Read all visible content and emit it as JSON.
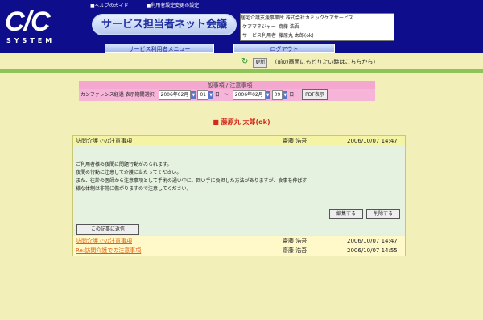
{
  "logo": {
    "text": "C/C",
    "sub": "SYSTEM"
  },
  "toplinks": [
    "■ヘルプのガイド",
    "■利用者設定変更の設定"
  ],
  "title": "サービス担当者ネット会議",
  "info": {
    "office": "居宅介護支援事業所 株式会社カミックケアサービス",
    "caremanager_label": "ケアマネジャー",
    "caremanager": "齋藤 浩吾",
    "user_label": "サービス利用者",
    "user": "藤原丸 太郎(ok)"
  },
  "nav": {
    "menu": "サービス利用者メニュー",
    "logout": "ログアウト"
  },
  "refresh": {
    "button": "更新",
    "text": "（前の画面にもどりたい時はこちらから）"
  },
  "filter": {
    "title": "一般事項 / 注意事項",
    "label": "カンファレンス経過 表示期間選択",
    "from_year": "2006年02月",
    "from_month": "01",
    "from_unit": "日",
    "tilde": "〜",
    "to_year": "2006年02月",
    "to_month": "09",
    "to_unit": "日",
    "pdf": "PDF表示"
  },
  "patient": "■ 藤原丸 太郎(ok)",
  "panel": {
    "head": {
      "title": "訪問介護での注意事項",
      "author": "齋藤 浩吾",
      "date": "2006/10/07 14:47"
    },
    "body": [
      "ご利用者様の夜間に問題行動がみられます。",
      "夜間の行動に注意して介護に当たってください。",
      "また、往診の医師から注意事項として手術の通い中に、回い手に負担した方法がありますが、食事を伸ばす",
      "様な体制は非常に傷がりますので注意してください。"
    ],
    "edit": "編集する",
    "delete": "削除する",
    "use": "この記事に返信",
    "rows": [
      {
        "title": "訪問介護での注意事項",
        "author": "齋藤 浩吾",
        "date": "2006/10/07 14:47"
      },
      {
        "title": "Re:訪問介護での注意事項",
        "author": "齋藤 浩吾",
        "date": "2006/10/07 14:55"
      }
    ]
  }
}
